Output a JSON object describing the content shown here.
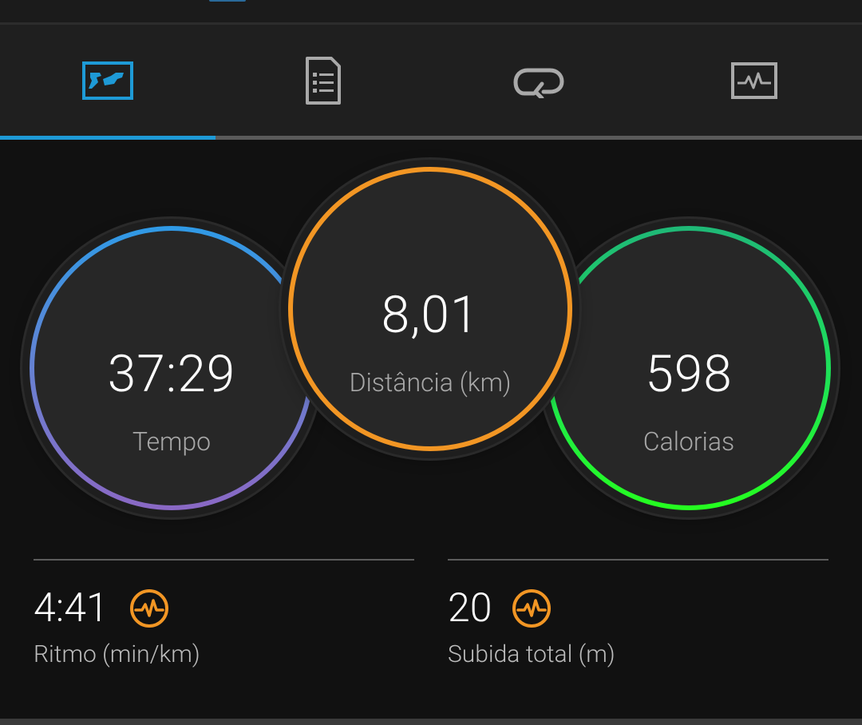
{
  "tabs": [
    {
      "icon": "stats-summary-icon",
      "active": true
    },
    {
      "icon": "document-list-icon",
      "active": false
    },
    {
      "icon": "laps-loop-icon",
      "active": false
    },
    {
      "icon": "chart-graph-icon",
      "active": false
    }
  ],
  "colors": {
    "accent": "#1e9ad6",
    "time_ring": [
      "#2f9ae6",
      "#8a68c4"
    ],
    "distance_ring": "#f29624",
    "calories_ring": [
      "#1fb877",
      "#25ff1f"
    ],
    "hr_icon": "#f29624"
  },
  "rings": {
    "time": {
      "value": "37:29",
      "label": "Tempo"
    },
    "distance": {
      "value": "8,01",
      "label": "Distância (km)"
    },
    "calories": {
      "value": "598",
      "label": "Calorias"
    }
  },
  "stats": {
    "pace": {
      "value": "4:41",
      "label": "Ritmo (min/km)",
      "icon": "heart-rate-icon"
    },
    "ascent": {
      "value": "20",
      "label": "Subida total (m)",
      "icon": "heart-rate-icon"
    }
  }
}
